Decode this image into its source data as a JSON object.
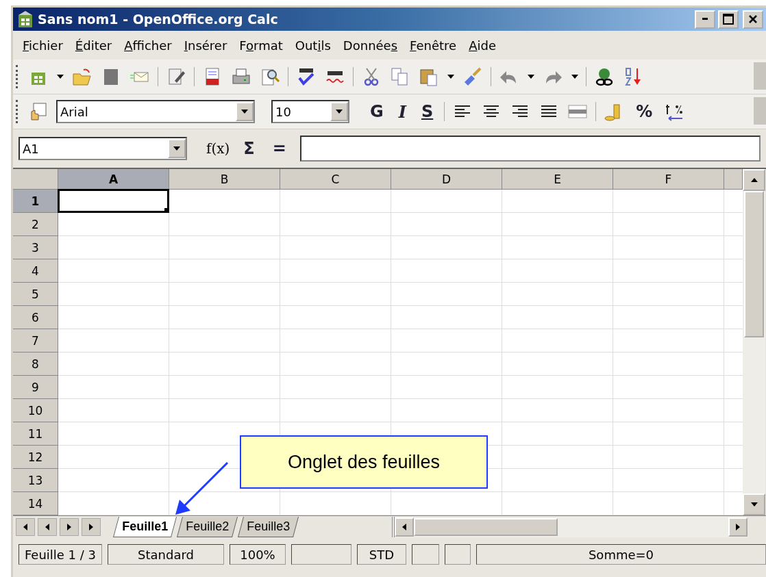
{
  "window": {
    "title": "Sans nom1 - OpenOffice.org Calc"
  },
  "menu": [
    {
      "key": "F",
      "post": "ichier"
    },
    {
      "key": "É",
      "post": "diter"
    },
    {
      "key": "A",
      "post": "fficher"
    },
    {
      "key": "I",
      "post": "nsérer"
    },
    {
      "pre": "F",
      "key": "o",
      "post": "rmat"
    },
    {
      "pre": "Out",
      "key": "i",
      "post": "ls"
    },
    {
      "pre": "Donnée",
      "key": "s"
    },
    {
      "key": "F",
      "post": "enêtre"
    },
    {
      "key": "A",
      "post": "ide"
    }
  ],
  "formatting": {
    "font": "Arial",
    "size": "10",
    "bold": "G",
    "italic": "I",
    "underline": "S",
    "percent": "%"
  },
  "formula_bar": {
    "name_box": "A1",
    "function": "f(x)",
    "sum": "Σ",
    "equals": "="
  },
  "columns": [
    {
      "label": "A",
      "selected": true
    },
    {
      "label": "B",
      "selected": false
    },
    {
      "label": "C",
      "selected": false
    },
    {
      "label": "D",
      "selected": false
    },
    {
      "label": "E",
      "selected": false
    },
    {
      "label": "F",
      "selected": false
    }
  ],
  "rows": [
    {
      "label": "1",
      "selected": true
    },
    {
      "label": "2",
      "selected": false
    },
    {
      "label": "3",
      "selected": false
    },
    {
      "label": "4",
      "selected": false
    },
    {
      "label": "5",
      "selected": false
    },
    {
      "label": "6",
      "selected": false
    },
    {
      "label": "7",
      "selected": false
    },
    {
      "label": "8",
      "selected": false
    },
    {
      "label": "9",
      "selected": false
    },
    {
      "label": "10",
      "selected": false
    },
    {
      "label": "11",
      "selected": false
    },
    {
      "label": "12",
      "selected": false
    },
    {
      "label": "13",
      "selected": false
    },
    {
      "label": "14",
      "selected": false
    }
  ],
  "sheet_tabs": [
    {
      "label": "Feuille1",
      "selected": true
    },
    {
      "label": "Feuille2",
      "selected": false
    },
    {
      "label": "Feuille3",
      "selected": false
    }
  ],
  "status_bar": [
    {
      "kind": "text",
      "text": "Feuille 1 / 3"
    },
    {
      "kind": "text",
      "text": "Standard"
    },
    {
      "kind": "text",
      "text": "100%"
    },
    {
      "kind": "blank"
    },
    {
      "kind": "text",
      "text": "STD"
    },
    {
      "kind": "blank"
    },
    {
      "kind": "blank"
    },
    {
      "kind": "text",
      "text": "Somme=0"
    }
  ],
  "callout": {
    "text": "Onglet des feuilles"
  }
}
